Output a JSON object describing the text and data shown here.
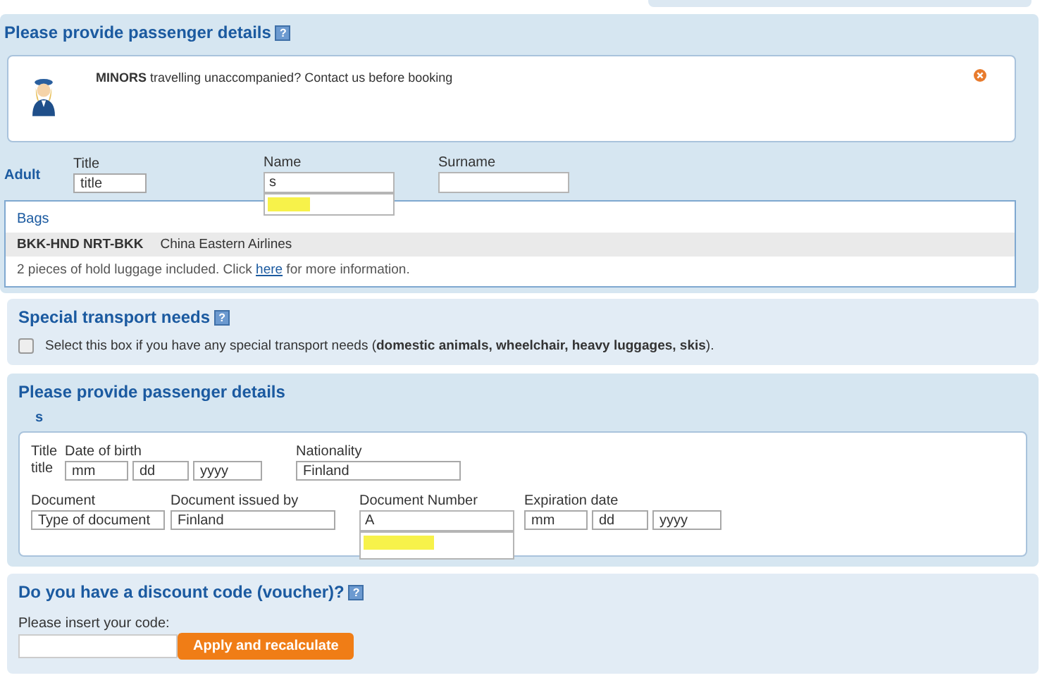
{
  "passenger_section": {
    "title": "Please provide passenger details",
    "help": "?",
    "notice": {
      "text": "**MINORS** travelling unaccompanied? Contact us before booking"
    },
    "passenger_type": "Adult",
    "title_field": {
      "label": "Title",
      "value": "title"
    },
    "name_field": {
      "label": "Name",
      "value": "s"
    },
    "surname_field": {
      "label": "Surname"
    },
    "bags": {
      "title": "Bags",
      "route": "BKK-HND NRT-BKK",
      "airline": "China Eastern Airlines",
      "info_before": "2 pieces of hold luggage included. Click ",
      "link": "here",
      "info_after": " for more information."
    }
  },
  "special_needs": {
    "title": "Special transport needs",
    "help": "?",
    "checked": false,
    "text": "Select this box if you have any special transport needs (**domestic animals, wheelchair, heavy luggages, skis**)."
  },
  "details_section": {
    "title": "Please provide passenger details",
    "passenger_name": "s",
    "title_label": "Title",
    "title_value": "title",
    "dob": {
      "label": "Date of birth",
      "month": "mm",
      "day": "dd",
      "year": "yyyy"
    },
    "nationality": {
      "label": "Nationality",
      "value": "Finland"
    },
    "document": {
      "label": "Document",
      "value": "Type of document"
    },
    "issued_by": {
      "label": "Document issued by",
      "value": "Finland"
    },
    "document_number": {
      "label": "Document Number",
      "value": "A"
    },
    "expiration": {
      "label": "Expiration date",
      "month": "mm",
      "day": "dd",
      "year": "yyyy"
    }
  },
  "voucher": {
    "title": "Do you have a discount code (voucher)?",
    "help": "?",
    "label": "Please insert your code:",
    "button": "Apply and recalculate"
  }
}
